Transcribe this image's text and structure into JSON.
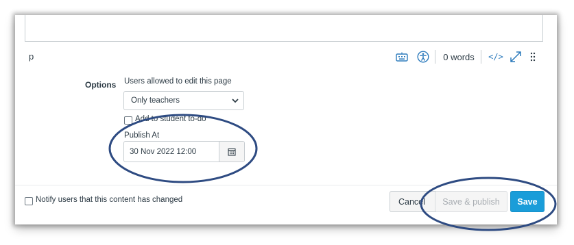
{
  "editor": {
    "path": "p",
    "word_count": "0 words",
    "html_toggle": "</>",
    "accent_color": "#2b7abc",
    "icons": [
      "keyboard-icon",
      "accessibility-icon",
      "fullscreen-icon",
      "drag-handle-icon"
    ]
  },
  "options": {
    "section_label": "Options",
    "edit_permission_label": "Users allowed to edit this page",
    "edit_permission_value": "Only teachers",
    "todo_label": "Add to student to-do",
    "todo_checked": false,
    "publish_at_label": "Publish At",
    "publish_at_value": "30 Nov 2022 12:00"
  },
  "footer": {
    "notify_label": "Notify users that this content has changed",
    "notify_checked": false,
    "cancel_label": "Cancel",
    "save_publish_label": "Save & publish",
    "save_label": "Save",
    "save_color": "#1a9dd9"
  },
  "annotation_color": "#2e4b82"
}
